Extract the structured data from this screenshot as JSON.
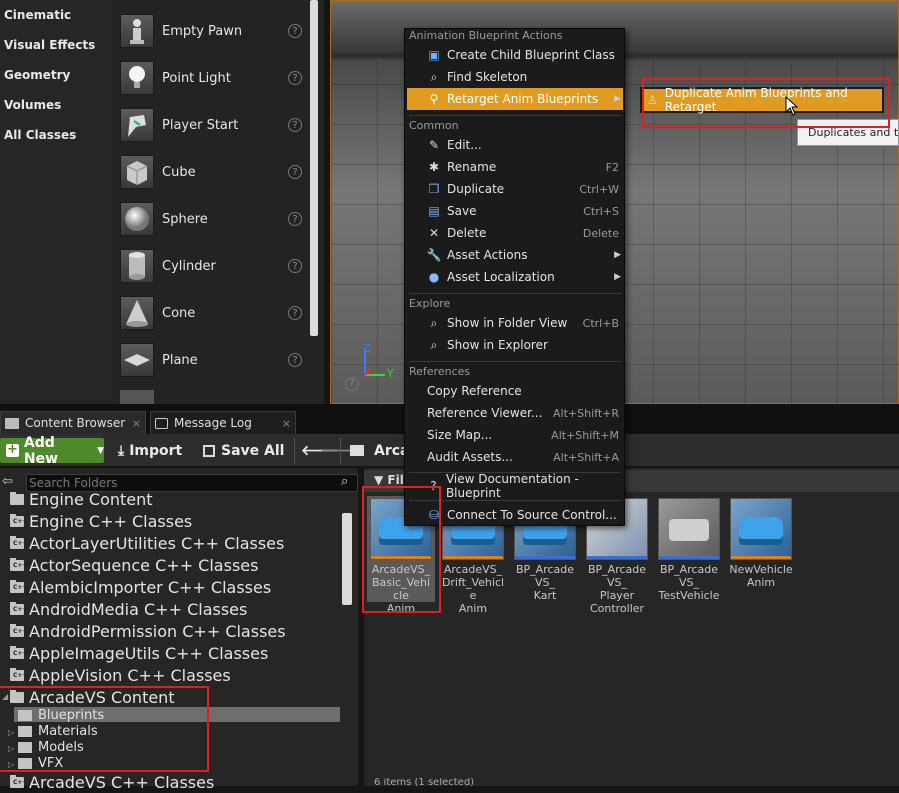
{
  "place_actors": {
    "categories": [
      "Cinematic",
      "Visual Effects",
      "Geometry",
      "Volumes",
      "All Classes"
    ],
    "actors": [
      {
        "label": "Empty Pawn",
        "icon": "empty-pawn-icon"
      },
      {
        "label": "Point Light",
        "icon": "point-light-icon"
      },
      {
        "label": "Player Start",
        "icon": "player-start-icon"
      },
      {
        "label": "Cube",
        "icon": "cube-icon"
      },
      {
        "label": "Sphere",
        "icon": "sphere-icon"
      },
      {
        "label": "Cylinder",
        "icon": "cylinder-icon"
      },
      {
        "label": "Cone",
        "icon": "cone-icon"
      },
      {
        "label": "Plane",
        "icon": "plane-icon"
      }
    ],
    "help_glyph": "?"
  },
  "viewport": {
    "axis_z": "Z",
    "axis_y": "Y",
    "help_glyph": "?"
  },
  "tabs": [
    {
      "label": "Content Browser",
      "close": "×"
    },
    {
      "label": "Message Log",
      "close": "×"
    }
  ],
  "toolbar": {
    "add_new": "Add New",
    "import": "Import",
    "save_all": "Save All",
    "path_root": "Arcade"
  },
  "folders": {
    "search_placeholder": "Search Folders",
    "items": [
      "Engine Content",
      "Engine C++ Classes",
      "ActorLayerUtilities C++ Classes",
      "ActorSequence C++ Classes",
      "AlembicImporter C++ Classes",
      "AndroidMedia C++ Classes",
      "AndroidPermission C++ Classes",
      "AppleImageUtils C++ Classes",
      "AppleVision C++ Classes",
      "ArcadeVS Content"
    ],
    "subfolders": [
      "Blueprints",
      "Materials",
      "Models",
      "VFX"
    ],
    "last_item": "ArcadeVS C++ Classes"
  },
  "assets": {
    "filter_label": "Filters",
    "items": [
      {
        "label": "ArcadeVS_Basic_VehicleAnim",
        "lines": [
          "ArcadeVS_",
          "Basic_Vehicle",
          "Anim"
        ]
      },
      {
        "label": "ArcadeVS_Drift_VehicleAnim",
        "lines": [
          "ArcadeVS_",
          "Drift_Vehicle",
          "Anim"
        ]
      },
      {
        "label": "BP_ArcadeVS_Kart",
        "lines": [
          "BP_ArcadeVS_",
          "Kart"
        ]
      },
      {
        "label": "BP_ArcadeVS_PlayerController",
        "lines": [
          "BP_ArcadeVS_",
          "Player",
          "Controller"
        ]
      },
      {
        "label": "BP_ArcadeVS_TestVehicle",
        "lines": [
          "BP_ArcadeVS_",
          "TestVehicle"
        ]
      },
      {
        "label": "NewVehicleAnim",
        "lines": [
          "NewVehicle",
          "Anim"
        ]
      }
    ],
    "status_text": "6 items (1 selected)"
  },
  "context_menu": {
    "sections": {
      "anim": "Animation Blueprint Actions",
      "common": "Common",
      "explore": "Explore",
      "references": "References"
    },
    "anim_items": [
      {
        "label": "Create Child Blueprint Class",
        "icon": "blueprint-icon"
      },
      {
        "label": "Find Skeleton",
        "icon": "magnifier-icon"
      },
      {
        "label": "Retarget Anim Blueprints",
        "icon": "retarget-icon",
        "submenu": true,
        "highlighted": true
      }
    ],
    "common_items": [
      {
        "label": "Edit...",
        "icon": "edit-icon",
        "shortcut": ""
      },
      {
        "label": "Rename",
        "icon": "rename-icon",
        "shortcut": "F2"
      },
      {
        "label": "Duplicate",
        "icon": "duplicate-icon",
        "shortcut": "Ctrl+W"
      },
      {
        "label": "Save",
        "icon": "save-icon",
        "shortcut": "Ctrl+S"
      },
      {
        "label": "Delete",
        "icon": "delete-icon",
        "shortcut": "Delete"
      },
      {
        "label": "Asset Actions",
        "icon": "wrench-icon",
        "shortcut": "",
        "submenu": true
      },
      {
        "label": "Asset Localization",
        "icon": "globe-icon",
        "shortcut": "",
        "submenu": true
      }
    ],
    "explore_items": [
      {
        "label": "Show in Folder View",
        "icon": "magnifier-icon",
        "shortcut": "Ctrl+B"
      },
      {
        "label": "Show in Explorer",
        "icon": "magnifier-icon",
        "shortcut": ""
      }
    ],
    "reference_items": [
      {
        "label": "Copy Reference",
        "shortcut": ""
      },
      {
        "label": "Reference Viewer...",
        "shortcut": "Alt+Shift+R"
      },
      {
        "label": "Size Map...",
        "shortcut": "Alt+Shift+M"
      },
      {
        "label": "Audit Assets...",
        "shortcut": "Alt+Shift+A"
      }
    ],
    "doc_item": {
      "label": "View Documentation - Blueprint",
      "icon": "help-icon"
    },
    "source_item": {
      "label": "Connect To Source Control...",
      "icon": "source-control-icon"
    }
  },
  "submenu": {
    "label": "Duplicate Anim Blueprints and Retarget",
    "icon": "retarget-figure-icon"
  },
  "tooltip": {
    "text": "Duplicates and then retargets"
  },
  "colors": {
    "highlight": "#e29b21",
    "annotation": "#e02020",
    "add_new": "#4f8a2a"
  }
}
